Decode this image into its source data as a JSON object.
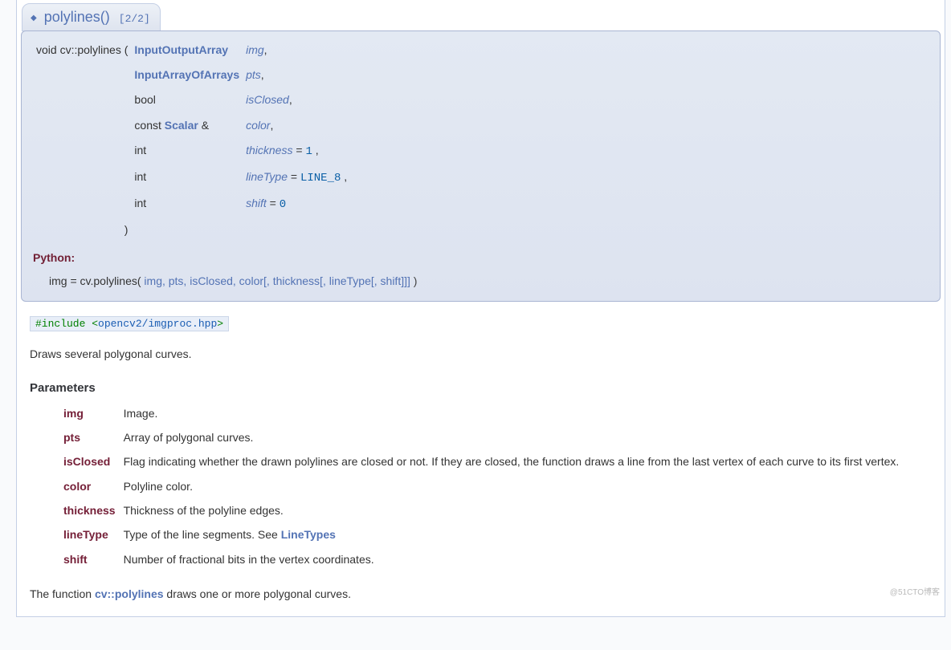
{
  "header": {
    "func_name": "polylines()",
    "overload": "[2/2]"
  },
  "proto": {
    "ret": "void",
    "scope": "cv::polylines",
    "open": "(",
    "rows": [
      {
        "type": "InputOutputArray",
        "type_link": true,
        "name": "img",
        "trail": ","
      },
      {
        "type": "InputArrayOfArrays",
        "type_link": true,
        "name": "pts",
        "trail": ","
      },
      {
        "type": "bool",
        "type_link": false,
        "name": "isClosed",
        "trail": ","
      },
      {
        "type_prefix": "const ",
        "type": "Scalar",
        "type_link": true,
        "type_suffix": " &",
        "name": "color",
        "trail": ","
      },
      {
        "type": "int",
        "type_link": false,
        "name": "thickness",
        "def_prefix": " = ",
        "def_val": "1",
        "trail": " ,"
      },
      {
        "type": "int",
        "type_link": false,
        "name": "lineType",
        "def_prefix": " = ",
        "def_val": "LINE_8",
        "trail": " ,"
      },
      {
        "type": "int",
        "type_link": false,
        "name": "shift",
        "def_prefix": " = ",
        "def_val": "0",
        "trail": ""
      }
    ],
    "close": ")"
  },
  "python": {
    "label": "Python:",
    "ret": "img",
    "eq": " = ",
    "obj": "cv.",
    "fn": "polylines(",
    "args": "img, pts, isClosed, color[, thickness[, lineType[, shift]]]",
    "close": " )"
  },
  "include": {
    "kw": "#include ",
    "lt": "<",
    "path": "opencv2/imgproc.hpp",
    "gt": ">"
  },
  "brief": "Draws several polygonal curves.",
  "params_heading": "Parameters",
  "params": [
    {
      "name": "img",
      "desc": "Image."
    },
    {
      "name": "pts",
      "desc": "Array of polygonal curves."
    },
    {
      "name": "isClosed",
      "desc": "Flag indicating whether the drawn polylines are closed or not. If they are closed, the function draws a line from the last vertex of each curve to its first vertex."
    },
    {
      "name": "color",
      "desc": "Polyline color."
    },
    {
      "name": "thickness",
      "desc": "Thickness of the polyline edges."
    },
    {
      "name": "lineType",
      "desc_prefix": "Type of the line segments. See ",
      "link": "LineTypes"
    },
    {
      "name": "shift",
      "desc": "Number of fractional bits in the vertex coordinates."
    }
  ],
  "footer": {
    "prefix": "The function ",
    "link": "cv::polylines",
    "suffix": " draws one or more polygonal curves."
  },
  "watermark": "@51CTO博客"
}
